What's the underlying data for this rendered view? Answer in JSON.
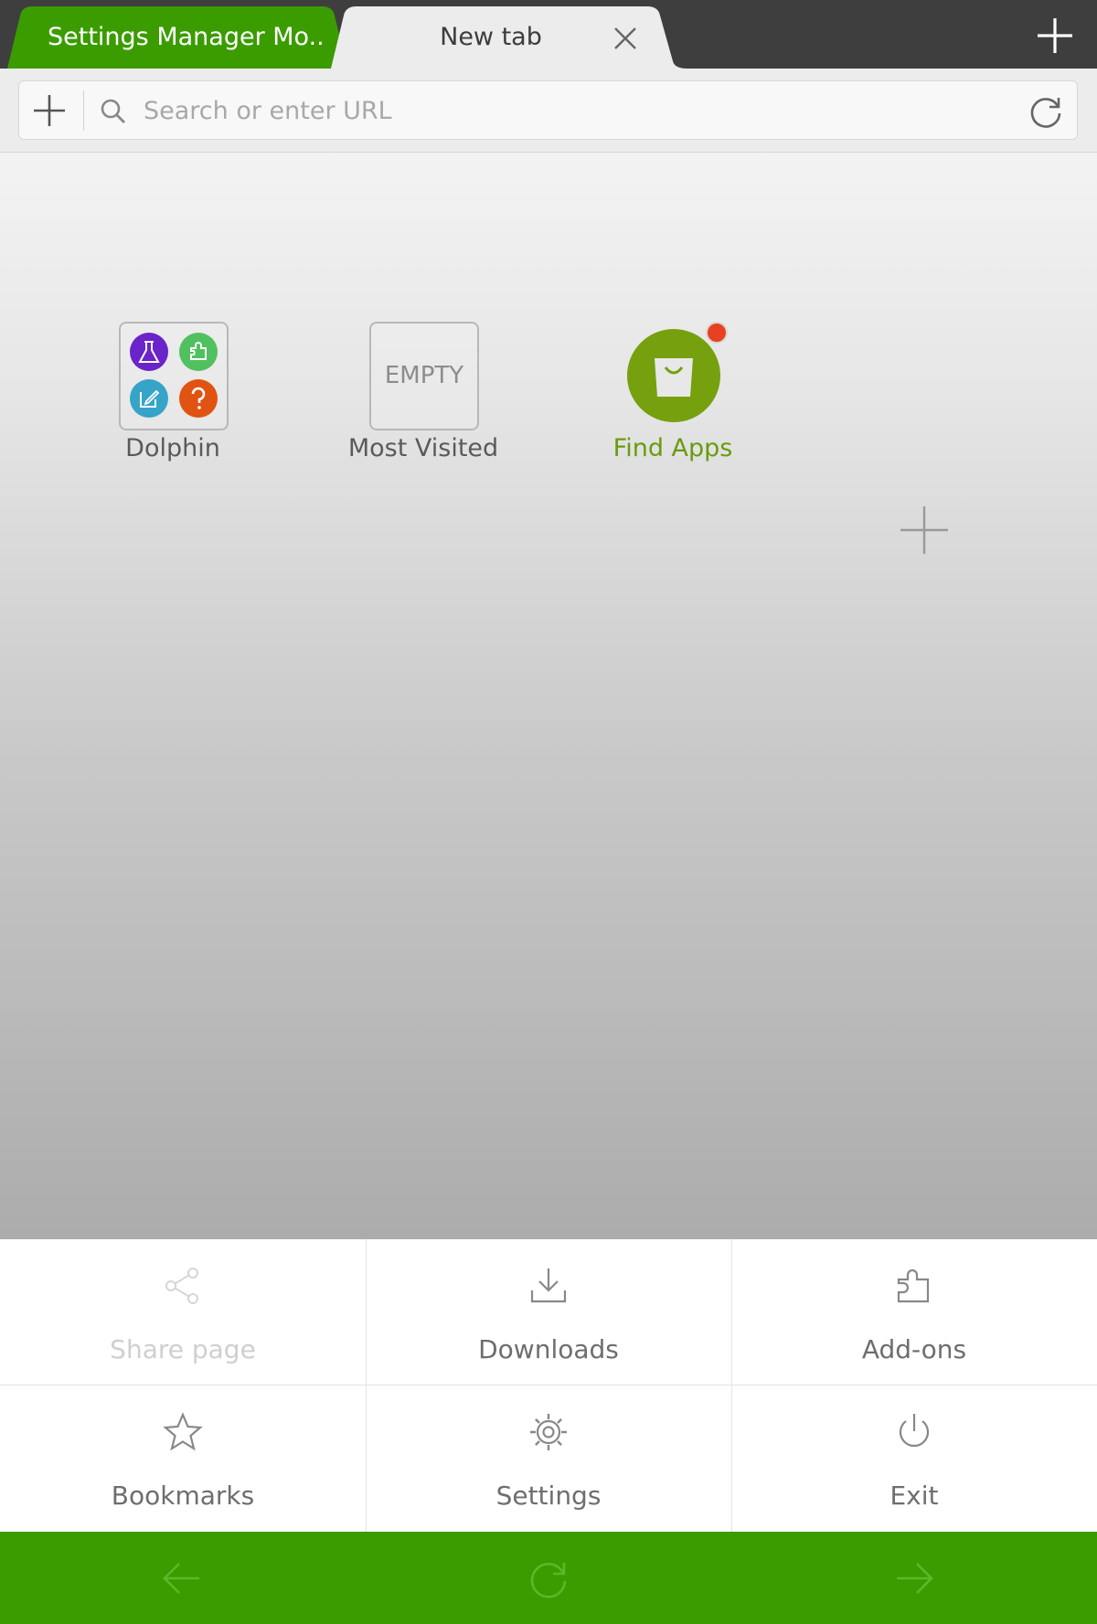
{
  "tabs": [
    {
      "label": "Settings Manager Mo...",
      "active": false,
      "color": "#3b9c00"
    },
    {
      "label": "New tab",
      "active": true
    }
  ],
  "address_bar": {
    "placeholder": "Search or enter URL",
    "value": ""
  },
  "speed_dial": [
    {
      "label": "Dolphin",
      "icons": [
        "flask-icon",
        "puzzle-icon",
        "edit-icon",
        "help-icon"
      ]
    },
    {
      "label": "Most Visited",
      "box_text": "EMPTY"
    },
    {
      "label": "Find Apps",
      "icon": "shopping-bag-icon",
      "notification": true,
      "accent": "#76a00e"
    }
  ],
  "menu": [
    {
      "label": "Share page",
      "icon": "share-icon",
      "enabled": false
    },
    {
      "label": "Downloads",
      "icon": "download-icon",
      "enabled": true
    },
    {
      "label": "Add-ons",
      "icon": "puzzle-icon",
      "enabled": true
    },
    {
      "label": "Bookmarks",
      "icon": "star-icon",
      "enabled": true
    },
    {
      "label": "Settings",
      "icon": "gear-icon",
      "enabled": true
    },
    {
      "label": "Exit",
      "icon": "power-icon",
      "enabled": true
    }
  ],
  "bottom_bar": {
    "color": "#3b9c00",
    "buttons": [
      "back-arrow-icon",
      "refresh-icon",
      "forward-arrow-icon"
    ]
  }
}
